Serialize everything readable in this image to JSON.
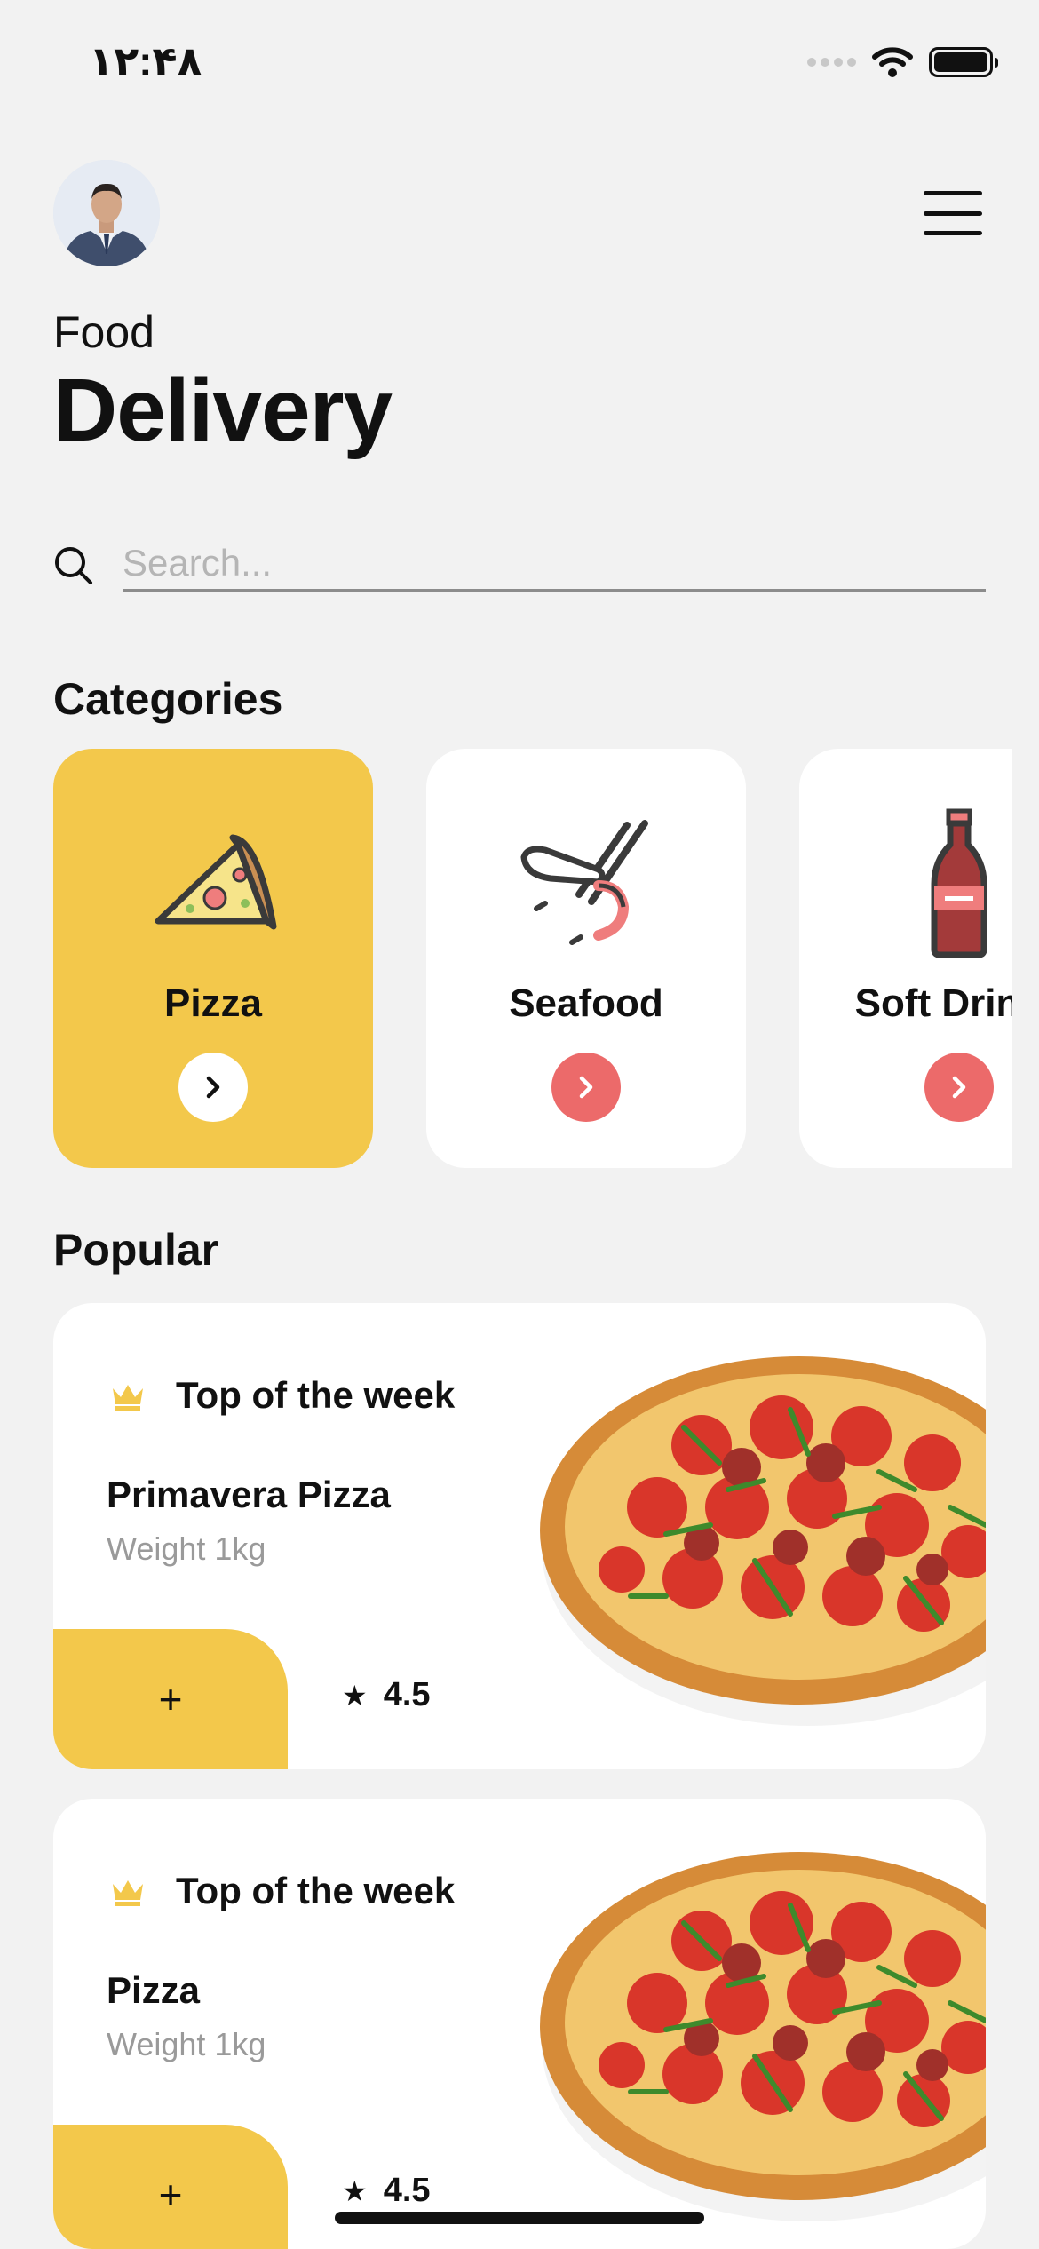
{
  "status_bar": {
    "time": "۱۲:۴۸"
  },
  "header": {
    "title_small": "Food",
    "title_big": "Delivery"
  },
  "search": {
    "placeholder": "Search..."
  },
  "categories": {
    "title": "Categories",
    "items": [
      {
        "label": "Pizza",
        "icon": "pizza-icon",
        "active": true
      },
      {
        "label": "Seafood",
        "icon": "shrimp-icon",
        "active": false
      },
      {
        "label": "Soft Drinks",
        "icon": "soda-bottle-icon",
        "active": false
      }
    ]
  },
  "popular": {
    "title": "Popular",
    "items": [
      {
        "tag": "Top of the week",
        "name": "Primavera Pizza",
        "weight": "Weight 1kg",
        "add_label": "+",
        "rating": "4.5"
      },
      {
        "tag": "Top of the week",
        "name": "Pizza",
        "weight": "Weight 1kg",
        "add_label": "+",
        "rating": "4.5"
      }
    ]
  },
  "colors": {
    "accent": "#f3c84b",
    "arrow": "#ec6a6a",
    "background": "#f2f2f2"
  }
}
